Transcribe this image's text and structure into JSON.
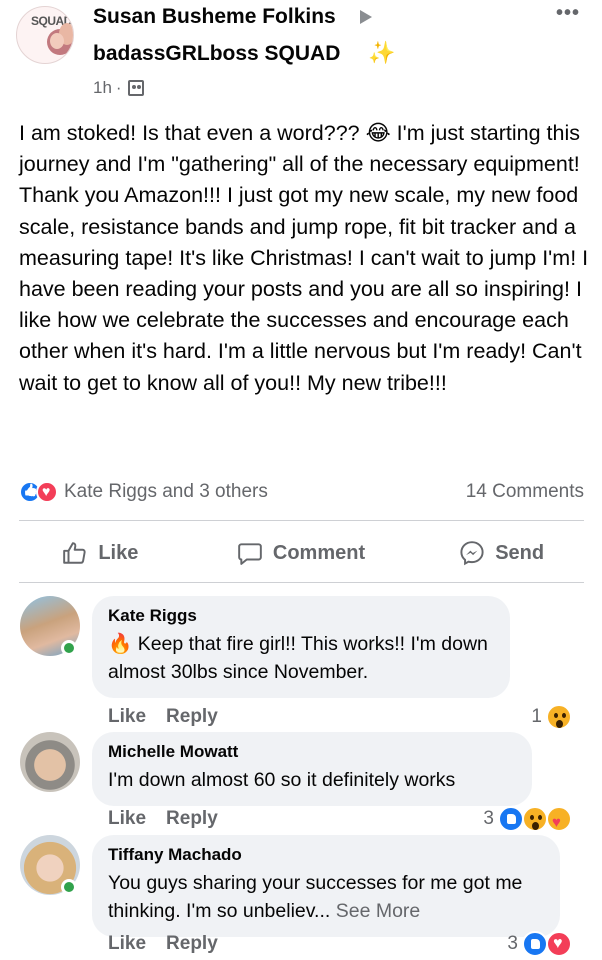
{
  "post": {
    "group_avatar_text": "SQUAD",
    "poster_name": "Susan Busheme Folkins",
    "group_name": "badassGRLboss SQUAD",
    "time": "1h",
    "meta_separator": "·",
    "body": "I am stoked! Is that even a word??? 😂 I'm just starting this journey and I'm \"gathering\" all of the necessary equipment! Thank you Amazon!!! I just got my new scale, my new food scale, resistance bands and jump rope, fit bit tracker and a measuring tape! It's like Christmas! I can't wait to jump I'm! I have been reading your posts and you are all so inspiring! I like how we celebrate the successes and encourage each other when it's hard. I'm a little nervous but I'm ready! Can't wait to get to know all of you!! My new tribe!!!",
    "reactions_text": "Kate Riggs and 3 others",
    "comments_count_text": "14 Comments"
  },
  "actions": {
    "like": "Like",
    "comment": "Comment",
    "send": "Send"
  },
  "comments": [
    {
      "name": "Kate Riggs",
      "emoji": "🔥",
      "text": "Keep that fire girl!! This works!! I'm down almost 30lbs since November.",
      "like": "Like",
      "reply": "Reply",
      "reaction_count": "1"
    },
    {
      "name": "Michelle Mowatt",
      "text": "I'm down almost 60 so it definitely works",
      "like": "Like",
      "reply": "Reply",
      "reaction_count": "3"
    },
    {
      "name": "Tiffany Machado",
      "text": "You guys sharing your successes for me got me thinking. I'm so unbeliev...",
      "see_more": "See More",
      "like": "Like",
      "reply": "Reply",
      "reaction_count": "3"
    }
  ],
  "colors": {
    "like_blue": "#1877f2",
    "love_red": "#f33e58",
    "online_green": "#31a24c",
    "secondary_text": "#65676b",
    "bubble_bg": "#f0f2f5"
  },
  "icons": [
    "more-dots-icon",
    "group-members-icon",
    "like-icon",
    "comment-icon",
    "messenger-icon",
    "wow-reaction-icon",
    "care-reaction-icon",
    "love-reaction-icon"
  ]
}
